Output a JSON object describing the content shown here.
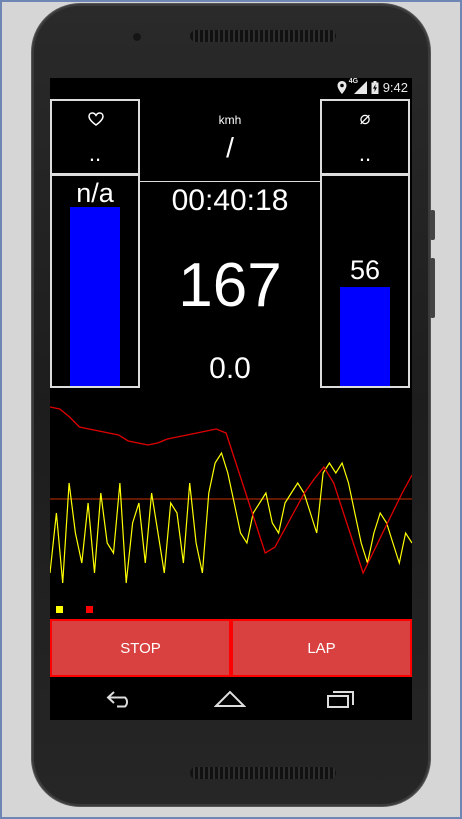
{
  "status_bar": {
    "time": "9:42",
    "network": "4G",
    "icons": [
      "location-icon",
      "signal-icon",
      "battery-charging-icon"
    ]
  },
  "heart_rate": {
    "icon": "heart-icon",
    "value": "..",
    "bar_label": "n/a",
    "bar_level": 0.94
  },
  "speed": {
    "unit": "kmh",
    "value": "/"
  },
  "average": {
    "icon": "average-icon",
    "symbol": "⌀",
    "value": "..",
    "bar_label": "56",
    "bar_level": 0.56
  },
  "main": {
    "elapsed_time": "00:40:18",
    "big_value": "167",
    "small_value": "0.0"
  },
  "chart_data": {
    "type": "line",
    "title": "",
    "xlabel": "",
    "ylabel": "",
    "series": [
      {
        "color": "#ffff00",
        "values": [
          0.15,
          0.45,
          0.1,
          0.6,
          0.35,
          0.2,
          0.5,
          0.15,
          0.55,
          0.3,
          0.25,
          0.6,
          0.1,
          0.4,
          0.5,
          0.2,
          0.55,
          0.35,
          0.15,
          0.5,
          0.45,
          0.2,
          0.6,
          0.3,
          0.15,
          0.55,
          0.7,
          0.75,
          0.65,
          0.5,
          0.35,
          0.3,
          0.45,
          0.5,
          0.55,
          0.4,
          0.35,
          0.5,
          0.55,
          0.6,
          0.55,
          0.45,
          0.35,
          0.65,
          0.7,
          0.65,
          0.7,
          0.6,
          0.45,
          0.3,
          0.2,
          0.35,
          0.45,
          0.4,
          0.3,
          0.2,
          0.35,
          0.3
        ]
      },
      {
        "color": "#e00000",
        "values": [
          0.98,
          0.97,
          0.93,
          0.88,
          0.87,
          0.86,
          0.85,
          0.84,
          0.81,
          0.8,
          0.79,
          0.8,
          0.82,
          0.83,
          0.84,
          0.85,
          0.86,
          0.87,
          0.85,
          0.7,
          0.55,
          0.4,
          0.25,
          0.28,
          0.37,
          0.46,
          0.55,
          0.62,
          0.68,
          0.6,
          0.45,
          0.3,
          0.15,
          0.25,
          0.35,
          0.45,
          0.55,
          0.64
        ]
      }
    ],
    "reference_line": 0.52,
    "legend": [
      {
        "color": "#ffff00"
      },
      {
        "color": "#ff0000"
      }
    ]
  },
  "buttons": {
    "stop_label": "STOP",
    "lap_label": "LAP"
  },
  "nav": {
    "icons": [
      "back-icon",
      "home-icon",
      "recents-icon"
    ]
  }
}
